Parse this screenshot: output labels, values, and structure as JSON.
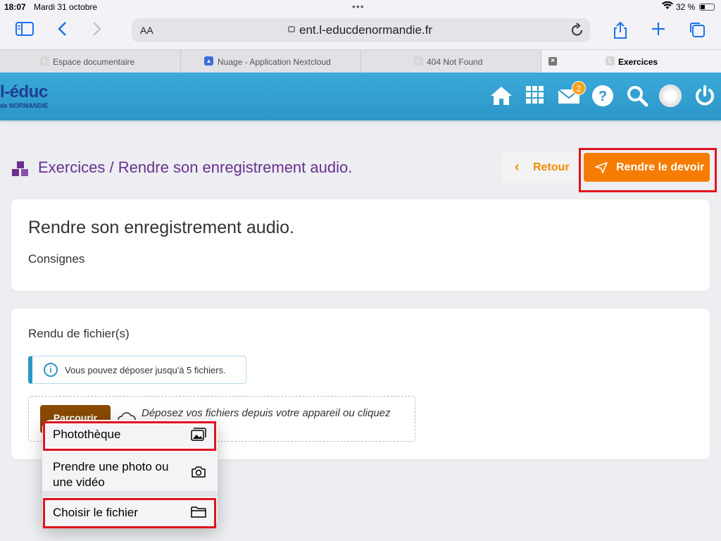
{
  "status": {
    "time": "18:07",
    "date": "Mardi 31 octobre",
    "battery": "32 %"
  },
  "browser": {
    "reader_label": "AA",
    "url": "ent.l-educdenormandie.fr",
    "tabs": [
      {
        "label": "Espace documentaire"
      },
      {
        "label": "Nuage - Application Nextcloud"
      },
      {
        "label": "404 Not Found"
      },
      {
        "label": "Exercices"
      }
    ]
  },
  "header": {
    "logo_line1": "l-éduc",
    "logo_line2": "de NORMANDIE",
    "notification_count": "2",
    "icons": [
      "home-icon",
      "apps-grid-icon",
      "mail-icon",
      "help-icon",
      "search-icon",
      "avatar",
      "power-icon"
    ]
  },
  "page": {
    "breadcrumb": "Exercices / Rendre son enregistrement audio.",
    "back_label": "Retour",
    "submit_label": "Rendre le devoir"
  },
  "assignment": {
    "title": "Rendre son enregistrement audio.",
    "subtitle": "Consignes"
  },
  "upload": {
    "heading": "Rendu de fichier(s)",
    "info": "Vous pouvez déposer jusqu'à 5 fichiers.",
    "browse_label": "Parcourir",
    "drop_text": "Déposez vos fichiers depuis votre appareil ou cliquez"
  },
  "menu": {
    "items": [
      {
        "label": "Photothèque",
        "icon": "photo-library-icon"
      },
      {
        "label": "Prendre une photo ou une vidéo",
        "icon": "camera-icon"
      },
      {
        "label": "Choisir le fichier",
        "icon": "folder-icon"
      }
    ]
  },
  "colors": {
    "header": "#2c97c8",
    "title": "#6a2f8f",
    "accent": "#f57c00",
    "highlight": "#e0141e"
  }
}
